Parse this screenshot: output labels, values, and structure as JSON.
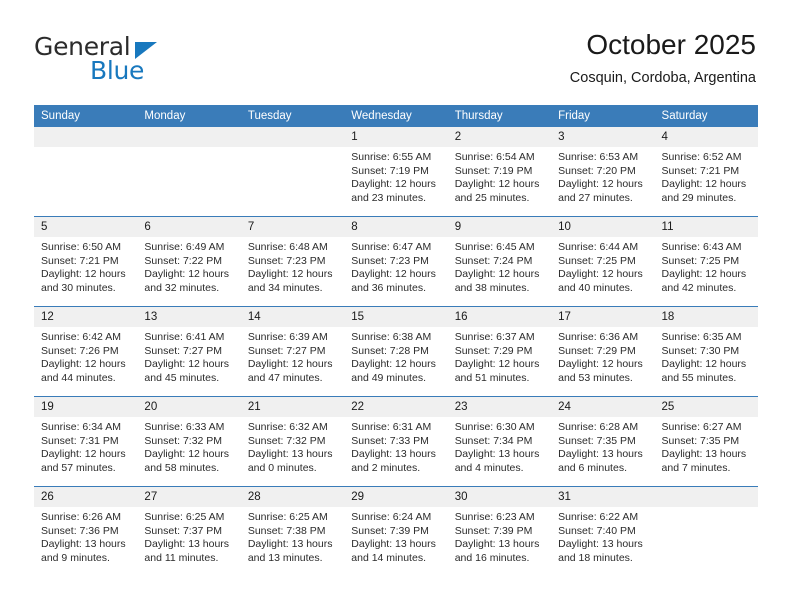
{
  "brand": {
    "name_line1": "General",
    "name_line2": "Blue",
    "accent_color": "#1878be"
  },
  "header": {
    "month_title": "October 2025",
    "location": "Cosquin, Cordoba, Argentina"
  },
  "calendar": {
    "header_bg": "#3a7cb9",
    "daynum_bg": "#f0f0f0",
    "weekdays": [
      "Sunday",
      "Monday",
      "Tuesday",
      "Wednesday",
      "Thursday",
      "Friday",
      "Saturday"
    ],
    "weeks": [
      [
        {
          "day": "",
          "empty": true
        },
        {
          "day": "",
          "empty": true
        },
        {
          "day": "",
          "empty": true
        },
        {
          "day": "1",
          "sunrise": "Sunrise: 6:55 AM",
          "sunset": "Sunset: 7:19 PM",
          "daylight": "Daylight: 12 hours and 23 minutes."
        },
        {
          "day": "2",
          "sunrise": "Sunrise: 6:54 AM",
          "sunset": "Sunset: 7:19 PM",
          "daylight": "Daylight: 12 hours and 25 minutes."
        },
        {
          "day": "3",
          "sunrise": "Sunrise: 6:53 AM",
          "sunset": "Sunset: 7:20 PM",
          "daylight": "Daylight: 12 hours and 27 minutes."
        },
        {
          "day": "4",
          "sunrise": "Sunrise: 6:52 AM",
          "sunset": "Sunset: 7:21 PM",
          "daylight": "Daylight: 12 hours and 29 minutes."
        }
      ],
      [
        {
          "day": "5",
          "sunrise": "Sunrise: 6:50 AM",
          "sunset": "Sunset: 7:21 PM",
          "daylight": "Daylight: 12 hours and 30 minutes."
        },
        {
          "day": "6",
          "sunrise": "Sunrise: 6:49 AM",
          "sunset": "Sunset: 7:22 PM",
          "daylight": "Daylight: 12 hours and 32 minutes."
        },
        {
          "day": "7",
          "sunrise": "Sunrise: 6:48 AM",
          "sunset": "Sunset: 7:23 PM",
          "daylight": "Daylight: 12 hours and 34 minutes."
        },
        {
          "day": "8",
          "sunrise": "Sunrise: 6:47 AM",
          "sunset": "Sunset: 7:23 PM",
          "daylight": "Daylight: 12 hours and 36 minutes."
        },
        {
          "day": "9",
          "sunrise": "Sunrise: 6:45 AM",
          "sunset": "Sunset: 7:24 PM",
          "daylight": "Daylight: 12 hours and 38 minutes."
        },
        {
          "day": "10",
          "sunrise": "Sunrise: 6:44 AM",
          "sunset": "Sunset: 7:25 PM",
          "daylight": "Daylight: 12 hours and 40 minutes."
        },
        {
          "day": "11",
          "sunrise": "Sunrise: 6:43 AM",
          "sunset": "Sunset: 7:25 PM",
          "daylight": "Daylight: 12 hours and 42 minutes."
        }
      ],
      [
        {
          "day": "12",
          "sunrise": "Sunrise: 6:42 AM",
          "sunset": "Sunset: 7:26 PM",
          "daylight": "Daylight: 12 hours and 44 minutes."
        },
        {
          "day": "13",
          "sunrise": "Sunrise: 6:41 AM",
          "sunset": "Sunset: 7:27 PM",
          "daylight": "Daylight: 12 hours and 45 minutes."
        },
        {
          "day": "14",
          "sunrise": "Sunrise: 6:39 AM",
          "sunset": "Sunset: 7:27 PM",
          "daylight": "Daylight: 12 hours and 47 minutes."
        },
        {
          "day": "15",
          "sunrise": "Sunrise: 6:38 AM",
          "sunset": "Sunset: 7:28 PM",
          "daylight": "Daylight: 12 hours and 49 minutes."
        },
        {
          "day": "16",
          "sunrise": "Sunrise: 6:37 AM",
          "sunset": "Sunset: 7:29 PM",
          "daylight": "Daylight: 12 hours and 51 minutes."
        },
        {
          "day": "17",
          "sunrise": "Sunrise: 6:36 AM",
          "sunset": "Sunset: 7:29 PM",
          "daylight": "Daylight: 12 hours and 53 minutes."
        },
        {
          "day": "18",
          "sunrise": "Sunrise: 6:35 AM",
          "sunset": "Sunset: 7:30 PM",
          "daylight": "Daylight: 12 hours and 55 minutes."
        }
      ],
      [
        {
          "day": "19",
          "sunrise": "Sunrise: 6:34 AM",
          "sunset": "Sunset: 7:31 PM",
          "daylight": "Daylight: 12 hours and 57 minutes."
        },
        {
          "day": "20",
          "sunrise": "Sunrise: 6:33 AM",
          "sunset": "Sunset: 7:32 PM",
          "daylight": "Daylight: 12 hours and 58 minutes."
        },
        {
          "day": "21",
          "sunrise": "Sunrise: 6:32 AM",
          "sunset": "Sunset: 7:32 PM",
          "daylight": "Daylight: 13 hours and 0 minutes."
        },
        {
          "day": "22",
          "sunrise": "Sunrise: 6:31 AM",
          "sunset": "Sunset: 7:33 PM",
          "daylight": "Daylight: 13 hours and 2 minutes."
        },
        {
          "day": "23",
          "sunrise": "Sunrise: 6:30 AM",
          "sunset": "Sunset: 7:34 PM",
          "daylight": "Daylight: 13 hours and 4 minutes."
        },
        {
          "day": "24",
          "sunrise": "Sunrise: 6:28 AM",
          "sunset": "Sunset: 7:35 PM",
          "daylight": "Daylight: 13 hours and 6 minutes."
        },
        {
          "day": "25",
          "sunrise": "Sunrise: 6:27 AM",
          "sunset": "Sunset: 7:35 PM",
          "daylight": "Daylight: 13 hours and 7 minutes."
        }
      ],
      [
        {
          "day": "26",
          "sunrise": "Sunrise: 6:26 AM",
          "sunset": "Sunset: 7:36 PM",
          "daylight": "Daylight: 13 hours and 9 minutes."
        },
        {
          "day": "27",
          "sunrise": "Sunrise: 6:25 AM",
          "sunset": "Sunset: 7:37 PM",
          "daylight": "Daylight: 13 hours and 11 minutes."
        },
        {
          "day": "28",
          "sunrise": "Sunrise: 6:25 AM",
          "sunset": "Sunset: 7:38 PM",
          "daylight": "Daylight: 13 hours and 13 minutes."
        },
        {
          "day": "29",
          "sunrise": "Sunrise: 6:24 AM",
          "sunset": "Sunset: 7:39 PM",
          "daylight": "Daylight: 13 hours and 14 minutes."
        },
        {
          "day": "30",
          "sunrise": "Sunrise: 6:23 AM",
          "sunset": "Sunset: 7:39 PM",
          "daylight": "Daylight: 13 hours and 16 minutes."
        },
        {
          "day": "31",
          "sunrise": "Sunrise: 6:22 AM",
          "sunset": "Sunset: 7:40 PM",
          "daylight": "Daylight: 13 hours and 18 minutes."
        },
        {
          "day": "",
          "empty": true
        }
      ]
    ]
  }
}
